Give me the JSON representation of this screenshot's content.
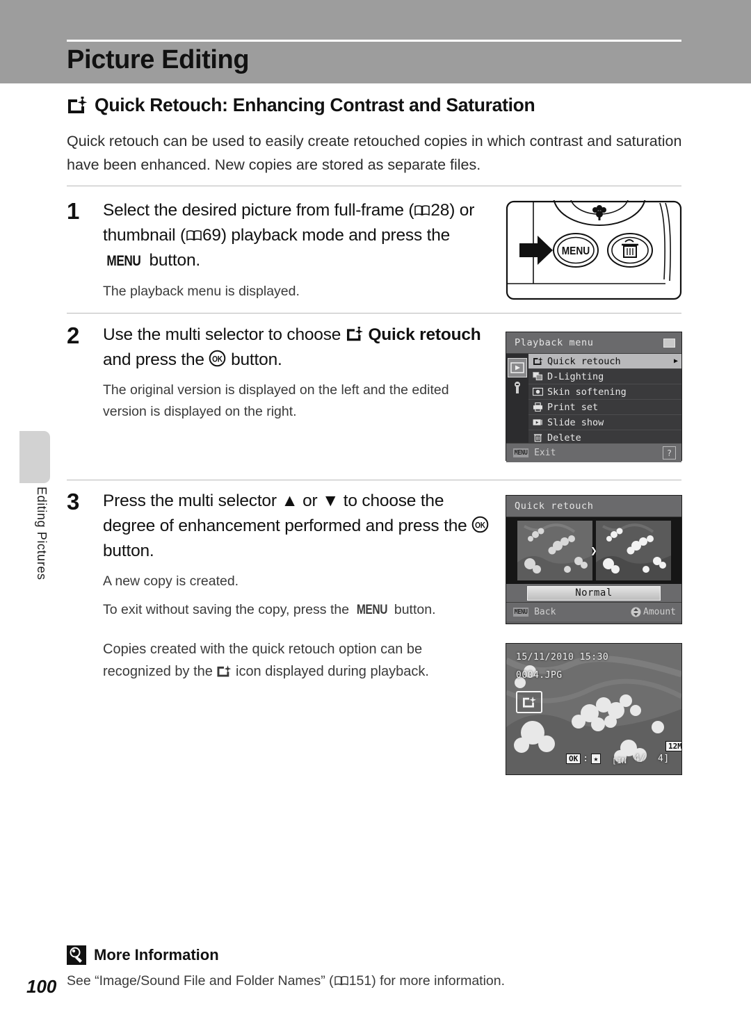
{
  "page": {
    "chapter_title": "Picture Editing",
    "page_number": "100",
    "side_tab_label": "Editing Pictures"
  },
  "section": {
    "icon": "quick-retouch-icon",
    "title": "Quick Retouch: Enhancing Contrast and Saturation",
    "intro": "Quick retouch can be used to easily create retouched copies in which contrast and saturation have been enhanced. New copies are stored as separate files."
  },
  "steps": [
    {
      "number": "1",
      "head_part1": "Select the desired picture from full-frame (",
      "ref1": "28",
      "head_part2": ") or thumbnail (",
      "ref2": "69",
      "head_part3": ") playback mode and press the ",
      "button": "MENU",
      "head_part4": " button.",
      "sub": "The playback menu is displayed."
    },
    {
      "number": "2",
      "head_part1": "Use the multi selector to choose ",
      "bold1": "Quick retouch",
      "head_part2": " and press the ",
      "button": "OK",
      "head_part3": " button.",
      "sub": "The original version is displayed on the left and the edited version is displayed on the right."
    },
    {
      "number": "3",
      "head_part1": "Press the multi selector ",
      "up": "▲",
      "head_part2": " or ",
      "down": "▼",
      "head_part3": " to choose the degree of enhancement performed and press the ",
      "button": "OK",
      "head_part4": " button.",
      "sub1": "A new copy is created.",
      "sub2_part1": "To exit without saving the copy, press the ",
      "sub2_button": "MENU",
      "sub2_part2": " button."
    }
  ],
  "note": {
    "part1": "Copies created with the quick retouch option can be recognized by the ",
    "icon": "quick-retouch-icon",
    "part2": " icon displayed during playback."
  },
  "camera_figure": {
    "menu_button_label": "MENU",
    "delete_button_icon": "trash-icon",
    "macro_icon": "macro-flower-icon",
    "pointer_icon": "arrow-right-icon"
  },
  "playback_menu_screen": {
    "title": "Playback menu",
    "rail": [
      {
        "icon": "playback-tab-icon",
        "active": true
      },
      {
        "icon": "setup-wrench-tab-icon",
        "active": false
      }
    ],
    "items": [
      {
        "icon": "quick-retouch-icon",
        "label": "Quick retouch",
        "selected": true
      },
      {
        "icon": "d-lighting-icon",
        "label": "D-Lighting",
        "selected": false
      },
      {
        "icon": "skin-softening-icon",
        "label": "Skin softening",
        "selected": false
      },
      {
        "icon": "print-set-icon",
        "label": "Print set",
        "selected": false
      },
      {
        "icon": "slide-show-icon",
        "label": "Slide show",
        "selected": false
      },
      {
        "icon": "delete-trash-icon",
        "label": "Delete",
        "selected": false
      }
    ],
    "footer_badge": "MENU",
    "footer_label": "Exit",
    "help_glyph": "?",
    "battery_icon": "battery-icon"
  },
  "quick_retouch_screen": {
    "title": "Quick retouch",
    "left_image_label": "original-preview",
    "right_image_label": "retouched-preview",
    "arrow_glyph": "❯",
    "amount_value": "Normal",
    "footer_badge": "MENU",
    "footer_back": "Back",
    "footer_updown_icon": "up-down-icon",
    "footer_amount": "Amount"
  },
  "playback_photo_screen": {
    "datetime": "15/11/2010 15:30",
    "filename": "0004.JPG",
    "retouch_icon": "quick-retouch-icon",
    "ok_badge": "OK",
    "ok_separator": ":",
    "star_glyph": "★",
    "memory_label": "[IN",
    "frame_current": "4/",
    "frame_total": "4]",
    "image_size": "12M"
  },
  "more_information": {
    "icon": "lightbulb-icon",
    "title": "More Information",
    "body": "See “Image/Sound File and Folder Names” (",
    "ref": "151",
    "body_tail": ") for more information."
  },
  "colors": {
    "header_band": "#9d9d9d",
    "lcd_body": "#5e5e60",
    "lcd_titlebar": "#6a6a6c",
    "menu_selected": "#b9b9bb",
    "side_tab": "#d2d2d2"
  }
}
